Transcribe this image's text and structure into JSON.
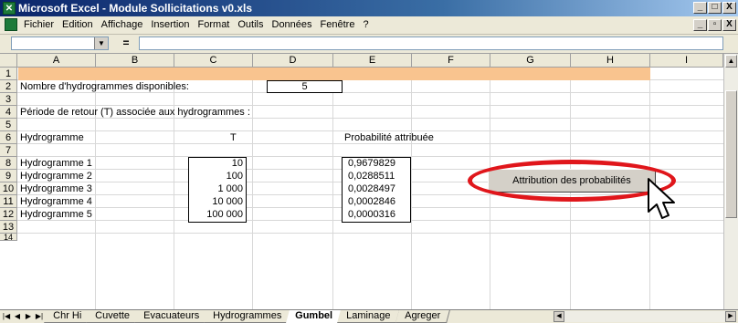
{
  "app": {
    "title": "Microsoft Excel - Module Sollicitations v0.xls",
    "icon": "excel-icon"
  },
  "window_buttons": [
    "_",
    "□",
    "X"
  ],
  "doc_buttons": [
    "_",
    "▫",
    "X"
  ],
  "menu": [
    "Fichier",
    "Edition",
    "Affichage",
    "Insertion",
    "Format",
    "Outils",
    "Données",
    "Fenêtre",
    "?"
  ],
  "formula_bar": {
    "name_box": "",
    "equals": "=",
    "content": ""
  },
  "columns": [
    "A",
    "B",
    "C",
    "D",
    "E",
    "F",
    "G",
    "H",
    "I"
  ],
  "rows": [
    "1",
    "2",
    "3",
    "4",
    "5",
    "6",
    "7",
    "8",
    "9",
    "10",
    "11",
    "12",
    "13",
    "14"
  ],
  "sheet": {
    "nb_label": "Nombre d'hydrogrammes disponibles:",
    "nb_value": "5",
    "periode_label": "Période de retour (T) associée aux hydrogrammes :",
    "hdr_hydrogramme": "Hydrogramme",
    "hdr_T": "T",
    "hdr_prob": "Probabilité attribuée",
    "hydrogrammes": [
      {
        "name": "Hydrogramme 1",
        "T": "10",
        "prob": "0,9679829"
      },
      {
        "name": "Hydrogramme 2",
        "T": "100",
        "prob": "0,0288511"
      },
      {
        "name": "Hydrogramme 3",
        "T": "1 000",
        "prob": "0,0028497"
      },
      {
        "name": "Hydrogramme 4",
        "T": "10 000",
        "prob": "0,0002846"
      },
      {
        "name": "Hydrogramme 5",
        "T": "100 000",
        "prob": "0,0000316"
      }
    ],
    "button_label": "Attribution des probabilités",
    "highlight_color": "#e0161b",
    "band_color": "#f9c48f"
  },
  "tabs": [
    "Chr Hi",
    "Cuvette",
    "Evacuateurs",
    "Hydrogrammes",
    "Gumbel",
    "Laminage",
    "Agreger"
  ],
  "active_tab": "Gumbel"
}
